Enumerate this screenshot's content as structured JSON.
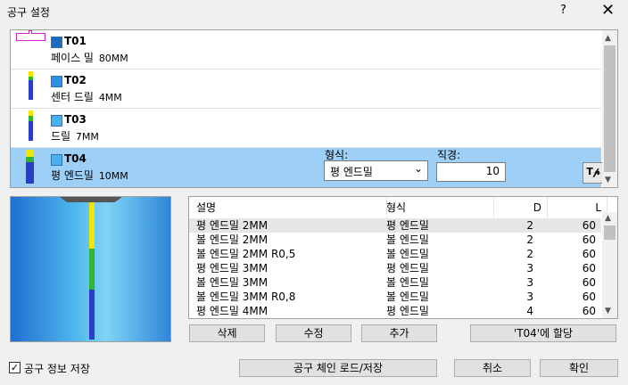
{
  "window": {
    "title": "공구 설정",
    "help": "?",
    "close": "✕"
  },
  "tools": [
    {
      "id": "T01",
      "name": "페이스 밀",
      "size": "80MM"
    },
    {
      "id": "T02",
      "name": "센터 드릴",
      "size": "4MM"
    },
    {
      "id": "T03",
      "name": "드릴",
      "size": "7MM"
    },
    {
      "id": "T04",
      "name": "평 엔드밀",
      "size": "10MM"
    }
  ],
  "selected_tool": {
    "type_label": "형식:",
    "type_value": "평 엔드밀",
    "diameter_label": "직경:",
    "diameter_value": "10",
    "settings_icon": "tool-settings-icon"
  },
  "library": {
    "columns": [
      "설명",
      "형식",
      "D",
      "L"
    ],
    "rows": [
      [
        "평 엔드밀 2MM",
        "평 엔드밀",
        "2",
        "60"
      ],
      [
        "볼 엔드밀 2MM",
        "볼 엔드밀",
        "2",
        "60"
      ],
      [
        "볼 엔드밀 2MM R0,5",
        "볼 엔드밀",
        "2",
        "60"
      ],
      [
        "평 엔드밀 3MM",
        "평 엔드밀",
        "3",
        "60"
      ],
      [
        "볼 엔드밀 3MM",
        "볼 엔드밀",
        "3",
        "60"
      ],
      [
        "볼 엔드밀 3MM R0,8",
        "볼 엔드밀",
        "3",
        "60"
      ],
      [
        "평 엔드밀 4MM",
        "평 엔드밀",
        "4",
        "60"
      ]
    ]
  },
  "buttons": {
    "delete": "삭제",
    "edit": "수정",
    "add": "추가",
    "assign": "'T04'에 할당",
    "chain": "공구 체인 로드/저장",
    "cancel": "취소",
    "ok": "확인"
  },
  "save_info": {
    "label": "공구 정보 저장",
    "checked": true
  },
  "colors": {
    "selection": "#9dcff7",
    "tool_blue": "#2f8fe4",
    "accent_yellow": "#f2e600",
    "accent_green": "#32b432",
    "accent_navy": "#2a3cc8"
  }
}
